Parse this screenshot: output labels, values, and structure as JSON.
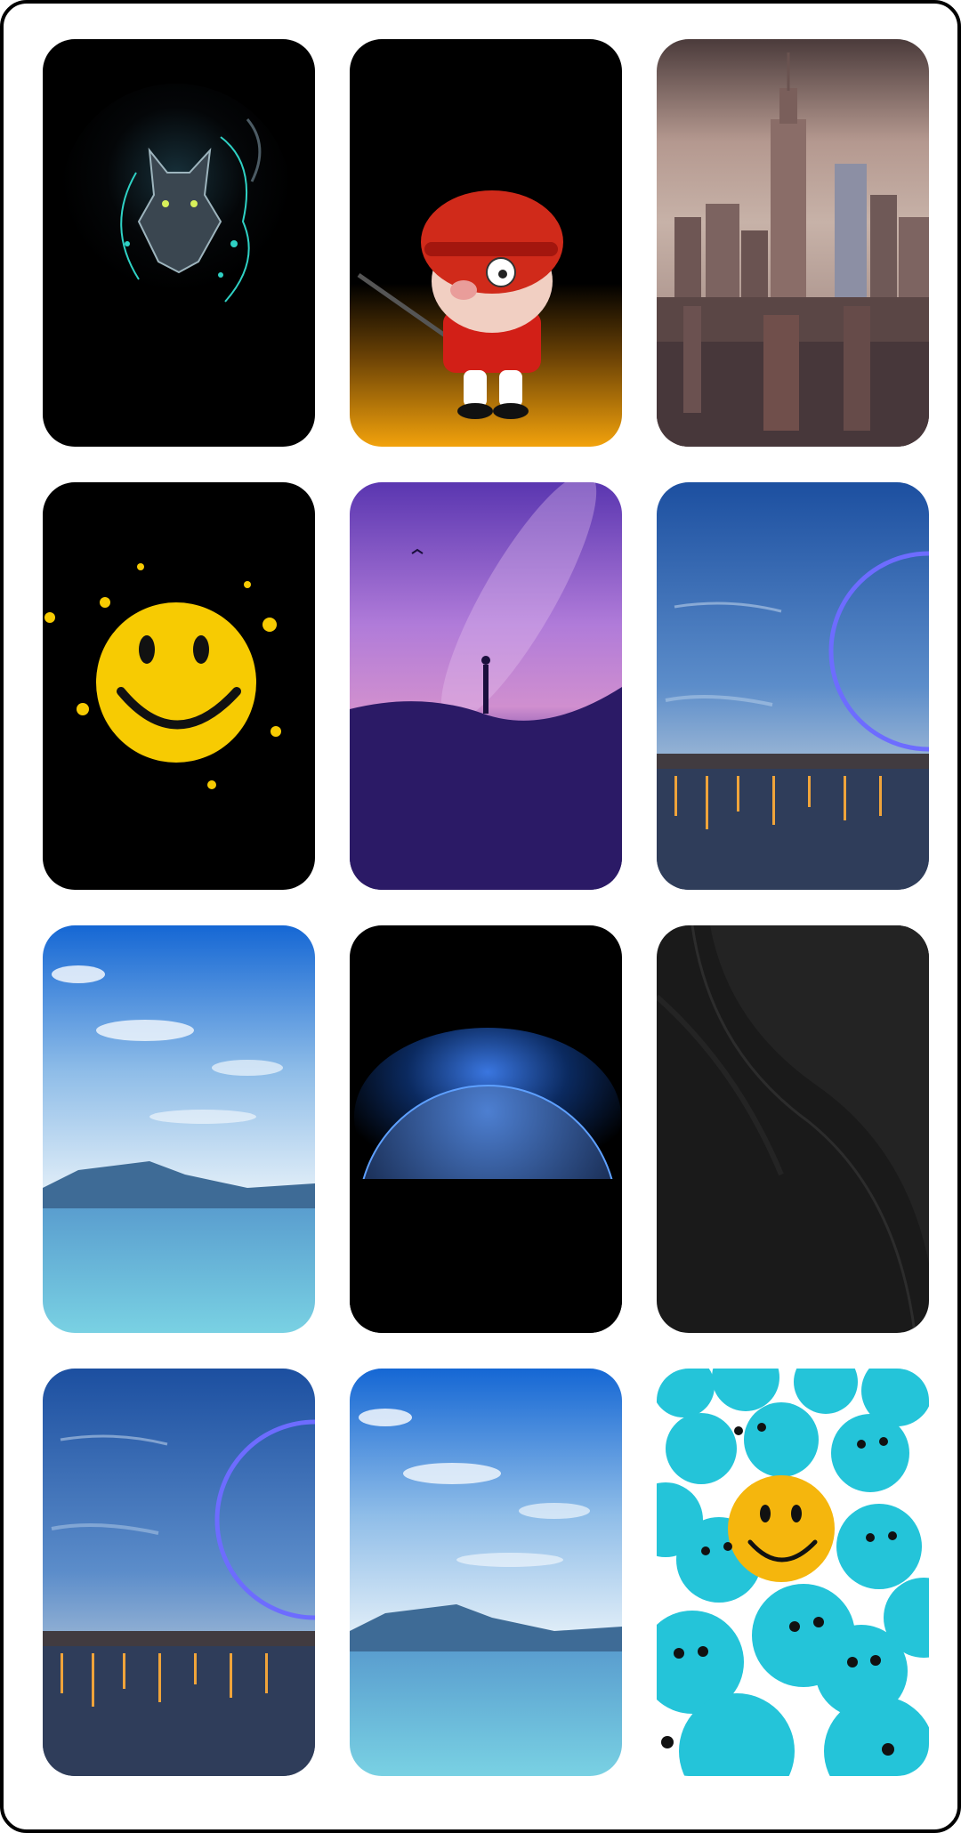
{
  "wallpaper_grid": {
    "items": [
      {
        "subject": "neon-wolf",
        "colors": {
          "bg": "#000000",
          "accent": "#2fd1c4"
        }
      },
      {
        "subject": "pig-mascot-red-helmet",
        "colors": {
          "bg": "#000000",
          "accent": "#f2a20c"
        }
      },
      {
        "subject": "city-skyline",
        "colors": {
          "bg": "#a88e86",
          "accent": "#5e4a49"
        }
      },
      {
        "subject": "yellow-smiley-splash",
        "colors": {
          "bg": "#000000",
          "accent": "#f7cb02"
        }
      },
      {
        "subject": "milky-way-silhouette",
        "colors": {
          "bg": "#6b3ac9",
          "accent": "#2b1a66"
        }
      },
      {
        "subject": "city-night-ferris-wheel",
        "colors": {
          "bg": "#1c4fa0",
          "accent": "#f0a43a"
        }
      },
      {
        "subject": "blue-lake-mountain",
        "colors": {
          "bg": "#1567d4",
          "accent": "#5fc3e0"
        }
      },
      {
        "subject": "earth-horizon-glow",
        "colors": {
          "bg": "#000000",
          "accent": "#2b6cd9"
        }
      },
      {
        "subject": "dark-abstract-wave",
        "colors": {
          "bg": "#1a1a1a",
          "accent": "#2c2c2c"
        }
      },
      {
        "subject": "city-night-ferris-wheel",
        "colors": {
          "bg": "#1c4fa0",
          "accent": "#f0a43a"
        }
      },
      {
        "subject": "blue-lake-mountain",
        "colors": {
          "bg": "#1567d4",
          "accent": "#5fc3e0"
        }
      },
      {
        "subject": "smiley-crowd-balls",
        "colors": {
          "bg": "#24c4d9",
          "accent": "#f5b60d"
        }
      }
    ]
  }
}
